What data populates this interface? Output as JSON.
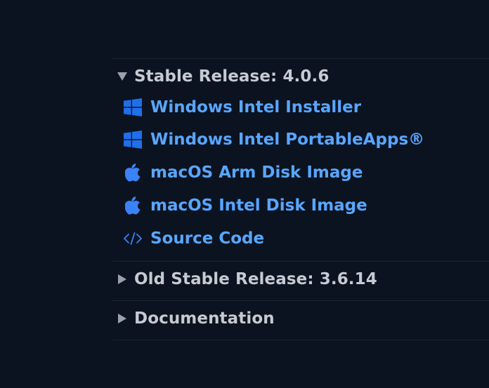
{
  "stable": {
    "title": "Stable Release: 4.0.6",
    "items": [
      {
        "label": "Windows Intel Installer",
        "icon": "windows-icon"
      },
      {
        "label": "Windows Intel PortableApps®",
        "icon": "windows-icon"
      },
      {
        "label": "macOS Arm Disk Image",
        "icon": "apple-icon"
      },
      {
        "label": "macOS Intel Disk Image",
        "icon": "apple-icon"
      },
      {
        "label": "Source Code",
        "icon": "code-icon"
      }
    ]
  },
  "old_stable": {
    "title": "Old Stable Release: 3.6.14"
  },
  "documentation": {
    "title": "Documentation"
  },
  "colors": {
    "background": "#0c1320",
    "link": "#58a6ff",
    "heading": "#c5cad3",
    "icon_windows": "#1f6feb",
    "icon_apple": "#3b82f6"
  }
}
